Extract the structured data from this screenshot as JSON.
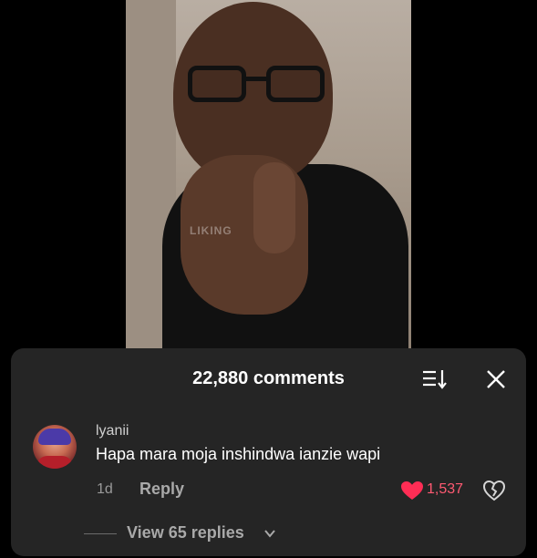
{
  "video": {
    "watermark": "LIKING"
  },
  "comments_panel": {
    "title": "22,880 comments",
    "icons": {
      "sort": "sort-icon",
      "close": "close-icon"
    }
  },
  "comment": {
    "username": "lyanii",
    "text": "Hapa mara moja inshindwa ianzie wapi",
    "age": "1d",
    "reply_label": "Reply",
    "like_count": "1,537",
    "liked": true,
    "like_color": "#ff2d55",
    "view_replies_label": "View 65 replies"
  }
}
